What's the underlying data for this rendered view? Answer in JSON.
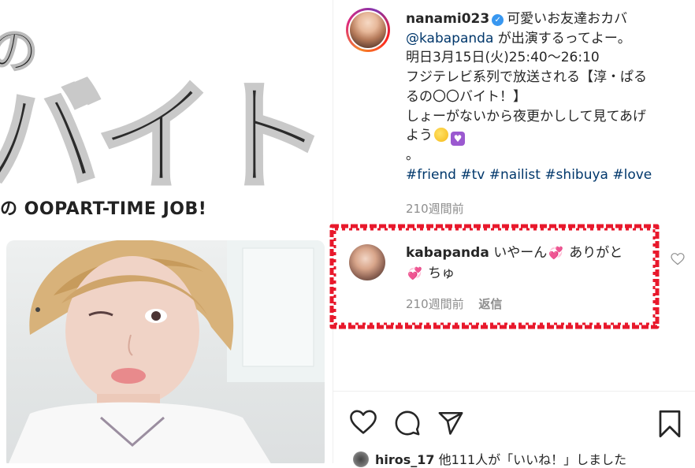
{
  "media": {
    "logo_top": "の",
    "logo_main": "バイト!",
    "logo_sub": "の OOPART-TIME JOB!"
  },
  "post": {
    "username": "nanami023",
    "caption_line1": "可愛いお友達おカバ",
    "mention": "@kabapanda",
    "caption_line2_rest": " が出演するってよー。",
    "caption_line3": "明日3月15日(火)25:40〜26:10",
    "caption_line4": "フジテレビ系列で放送される【淳・ぱる",
    "caption_line5": "るの〇〇バイト！】",
    "caption_line6": "しょーがないから夜更かしして見てあげ",
    "caption_line7": "よう",
    "caption_line8": "。",
    "hashtags": [
      "#friend",
      "#tv",
      "#nailist",
      "#shibuya",
      "#love"
    ],
    "time": "210週間前"
  },
  "comment": {
    "username": "kabapanda",
    "text_part1": " いやーん",
    "text_part2": " ありがと",
    "text_part3": " ちゅ",
    "time": "210週間前",
    "reply_label": "返信"
  },
  "likes": {
    "user": "hiros_17",
    "text": " 他111人が「いいね！」しました"
  },
  "colors": {
    "highlight": "#e8192c",
    "link": "#00376b",
    "muted": "#8e8e8e"
  },
  "icons": {
    "verified": "verified-badge-icon",
    "like": "heart-outline-icon",
    "comment": "comment-bubble-icon",
    "share": "paper-plane-icon",
    "save": "bookmark-icon"
  }
}
